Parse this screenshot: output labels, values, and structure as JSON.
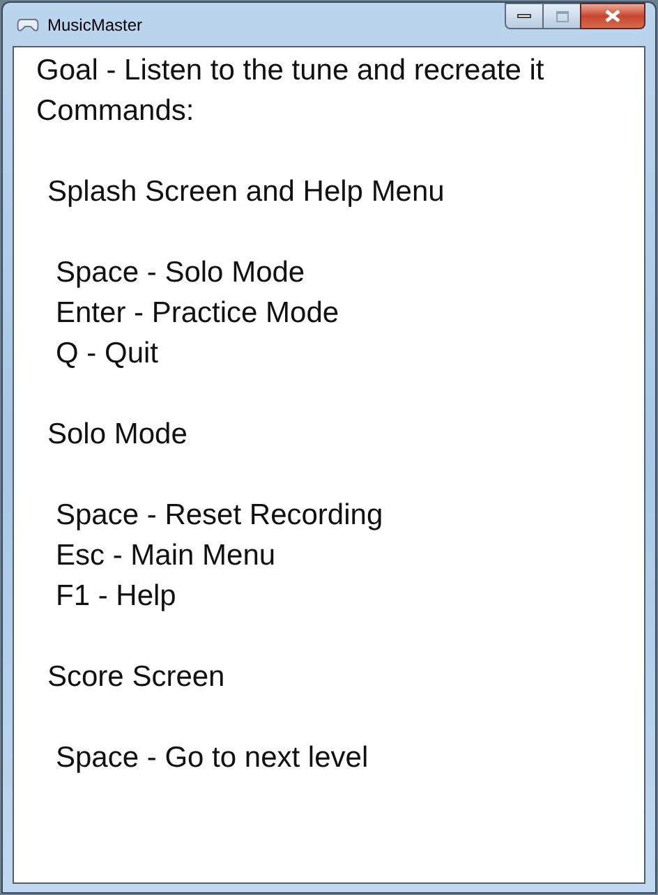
{
  "window": {
    "title": "MusicMaster"
  },
  "intro": [
    "Goal - Listen to the tune and recreate it",
    "Commands:"
  ],
  "sections": [
    {
      "heading": "Splash Screen and Help Menu",
      "commands": [
        "Space - Solo Mode",
        "Enter - Practice Mode",
        "Q - Quit"
      ]
    },
    {
      "heading": "Solo Mode",
      "commands": [
        "Space - Reset Recording",
        "Esc - Main Menu",
        "F1 - Help"
      ]
    },
    {
      "heading": "Score Screen",
      "commands": [
        "Space - Go to next level"
      ]
    }
  ]
}
